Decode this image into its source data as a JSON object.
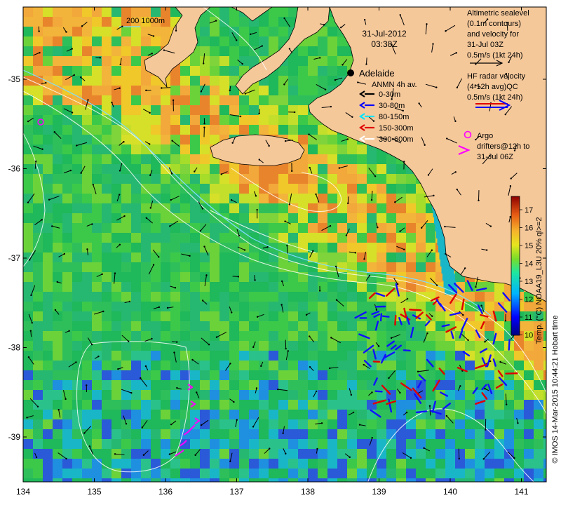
{
  "map": {
    "datetime_date": "31-Jul-2012",
    "datetime_time": "03:38Z",
    "scale_label": "200  1000m",
    "place": "Adelaide",
    "x_ticks": [
      "134",
      "135",
      "136",
      "137",
      "138",
      "139",
      "140",
      "141"
    ],
    "y_ticks": [
      "-35",
      "-36",
      "-37",
      "-38",
      "-39"
    ]
  },
  "legend": {
    "altimetric": [
      "Altimetric sealevel",
      "(0.1m contours)",
      "and velocity for",
      "31-Jul 03Z",
      "0.5m/s (1kt 24h)"
    ],
    "hf_radar": [
      "HF radar velocity",
      "(4-12h avg)QC",
      "0.5m/s (1kt 24h)"
    ],
    "anmn_title": "ANMN 4h av.",
    "anmn_items": [
      {
        "label": "0-30m",
        "color": "#000000"
      },
      {
        "label": "30-80m",
        "color": "#0000ff"
      },
      {
        "label": "80-150m",
        "color": "#00e5ff"
      },
      {
        "label": "150-300m",
        "color": "#e00000"
      },
      {
        "label": "300-600m",
        "color": "#ffffff"
      }
    ],
    "argo": "Argo",
    "drifters": [
      "drifters@12h to",
      "31-Jul 06Z"
    ]
  },
  "colorbar": {
    "title": "Temp. (°C) NOAA19_L3U 20% ql>=2",
    "ticks": [
      "17",
      "16",
      "15",
      "14",
      "13",
      "12",
      "11",
      "10"
    ]
  },
  "credit": "© IMOS 14-Mar-2015 10:44:21 Hobart time"
}
